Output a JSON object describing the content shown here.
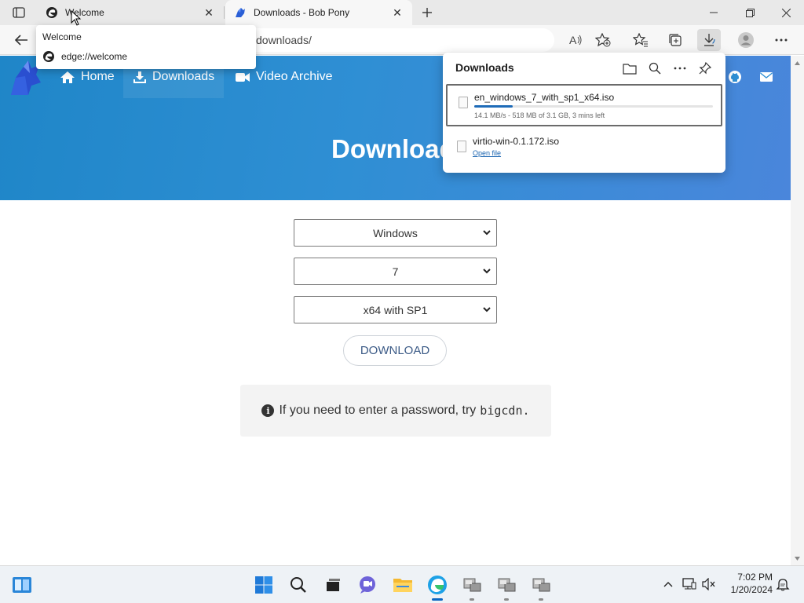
{
  "browser": {
    "tabs": [
      {
        "title": "Welcome",
        "active": false
      },
      {
        "title": "Downloads - Bob Pony",
        "active": true
      }
    ],
    "address_text": "downloads/",
    "tab_hover_card": {
      "title": "Welcome",
      "url": "edge://welcome"
    }
  },
  "page": {
    "nav": [
      {
        "label": "Home",
        "icon": "home-icon"
      },
      {
        "label": "Downloads",
        "icon": "download-icon"
      },
      {
        "label": "Video Archive",
        "icon": "video-icon"
      }
    ],
    "hero_title": "Downloads",
    "selects": {
      "os": "Windows",
      "version": "7",
      "edition": "x64 with SP1"
    },
    "download_button": "DOWNLOAD",
    "note": {
      "text": "If you need to enter a password, try",
      "code": "bigcdn."
    }
  },
  "downloads_panel": {
    "title": "Downloads",
    "items": [
      {
        "filename": "en_windows_7_with_sp1_x64.iso",
        "status": "14.1 MB/s - 518 MB of 3.1 GB, 3 mins left",
        "progress": 0.16
      },
      {
        "filename": "virtio-win-0.1.172.iso",
        "link": "Open file"
      }
    ]
  },
  "taskbar": {
    "time": "7:02 PM",
    "date": "1/20/2024"
  },
  "colors": {
    "hero_start": "#1f86c8",
    "hero_end": "#4a86db",
    "progress": "#1e6bb8",
    "link": "#1a64b0"
  }
}
